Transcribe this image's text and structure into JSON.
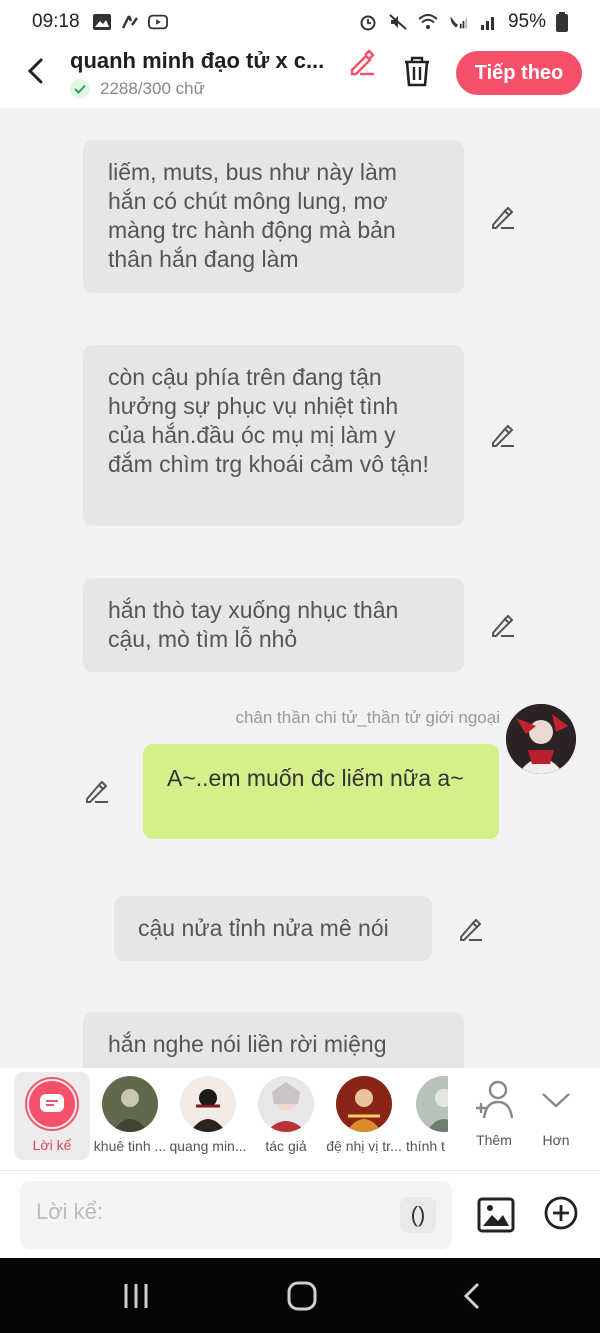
{
  "status_bar": {
    "time": "09:18",
    "battery": "95%"
  },
  "header": {
    "title": "quanh minh đạo tử x c...",
    "word_count": "2288/300 chữ",
    "next_label": "Tiếp theo"
  },
  "messages": [
    {
      "type": "narration",
      "text": "liếm, muts, bus như này làm hắn có chút mông lung, mơ màng trc hành động mà bản thân hắn đang làm"
    },
    {
      "type": "narration",
      "text": "còn cậu phía trên đang tận hưởng sự phục vụ nhiệt tình của hắn.đầu óc mụ mị làm y đắm chìm trg khoái cảm vô tận!"
    },
    {
      "type": "narration",
      "text": "hắn thò tay xuống nhục thân cậu, mò tìm lỗ nhỏ"
    },
    {
      "type": "character",
      "speaker": "chân thần chi tử_thần tử giới ngoại",
      "text": "A~..em muốn đc liếm nữa a~"
    },
    {
      "type": "narration",
      "text": "cậu nửa tỉnh nửa mê nói"
    },
    {
      "type": "narration",
      "text": "hắn nghe nói liền rời miệng"
    }
  ],
  "characters": [
    {
      "label": "Lời kể"
    },
    {
      "label": "khuê tinh ..."
    },
    {
      "label": "quang min..."
    },
    {
      "label": "tác giả"
    },
    {
      "label": "đệ nhị vị tr..."
    },
    {
      "label": "thính t"
    },
    {
      "label": "Thêm"
    },
    {
      "label": "Hơn"
    }
  ],
  "input": {
    "placeholder": "Lời kể:",
    "paren_label": "()"
  },
  "colors": {
    "accent": "#f4506a",
    "user_bubble": "#d4f08a",
    "narration_bubble": "#e6e6e6",
    "background": "#f2f2f2"
  },
  "icons": [
    "back-icon",
    "pencil-icon",
    "trash-icon",
    "check-icon",
    "image-icon",
    "plus-circle-icon",
    "person-add-icon",
    "chevron-down-icon"
  ]
}
